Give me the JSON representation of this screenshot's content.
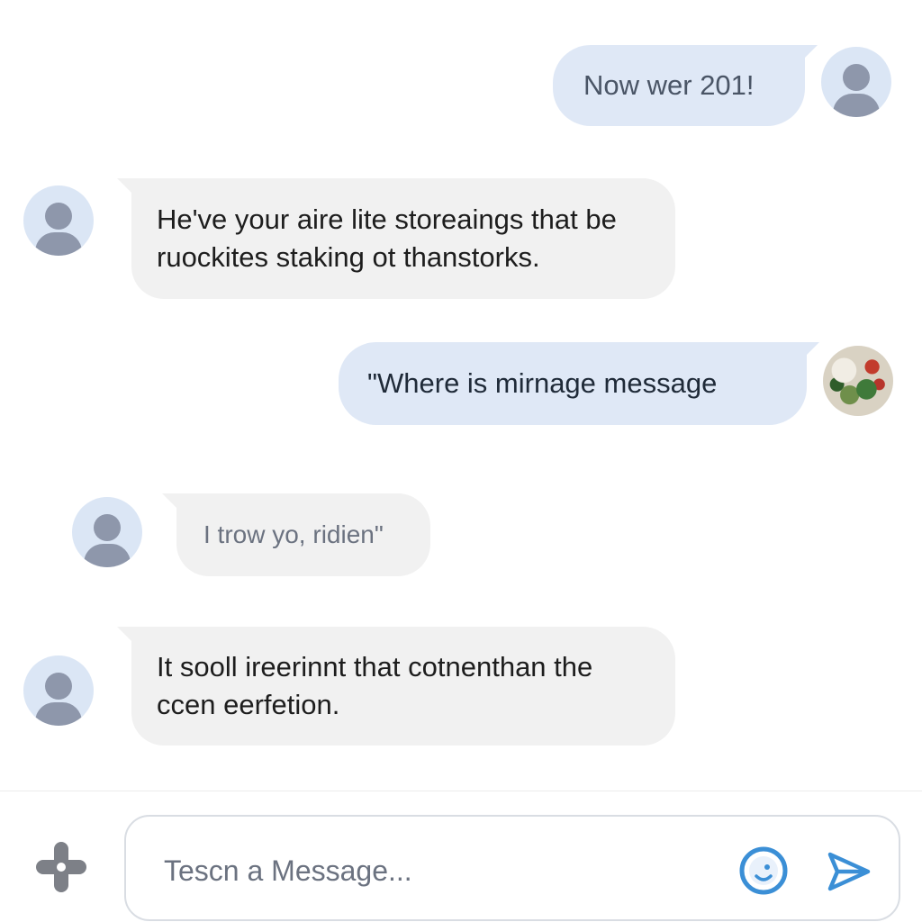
{
  "messages": [
    {
      "direction": "sent",
      "text": "Now wer 201!"
    },
    {
      "direction": "received",
      "text": "He've your aire lite storeaings that be ruockites staking ot thanstorks."
    },
    {
      "direction": "sent",
      "text": "\"Where is mirnage message"
    },
    {
      "direction": "received",
      "text": "I trow yo, ridien\""
    },
    {
      "direction": "received",
      "text": "It sooll ireerinnt that cotnenthan the ccen eerfetion."
    }
  ],
  "composer": {
    "placeholder": "Tescn a Message..."
  },
  "icons": {
    "attach": "plus-icon",
    "emoji": "emoji-icon",
    "send": "send-icon",
    "avatar": "user-avatar-icon"
  },
  "colors": {
    "sent_bubble": "#dfe8f6",
    "received_bubble": "#f1f1f1",
    "accent": "#3b8fd6",
    "avatar_bg": "#dbe6f5"
  }
}
